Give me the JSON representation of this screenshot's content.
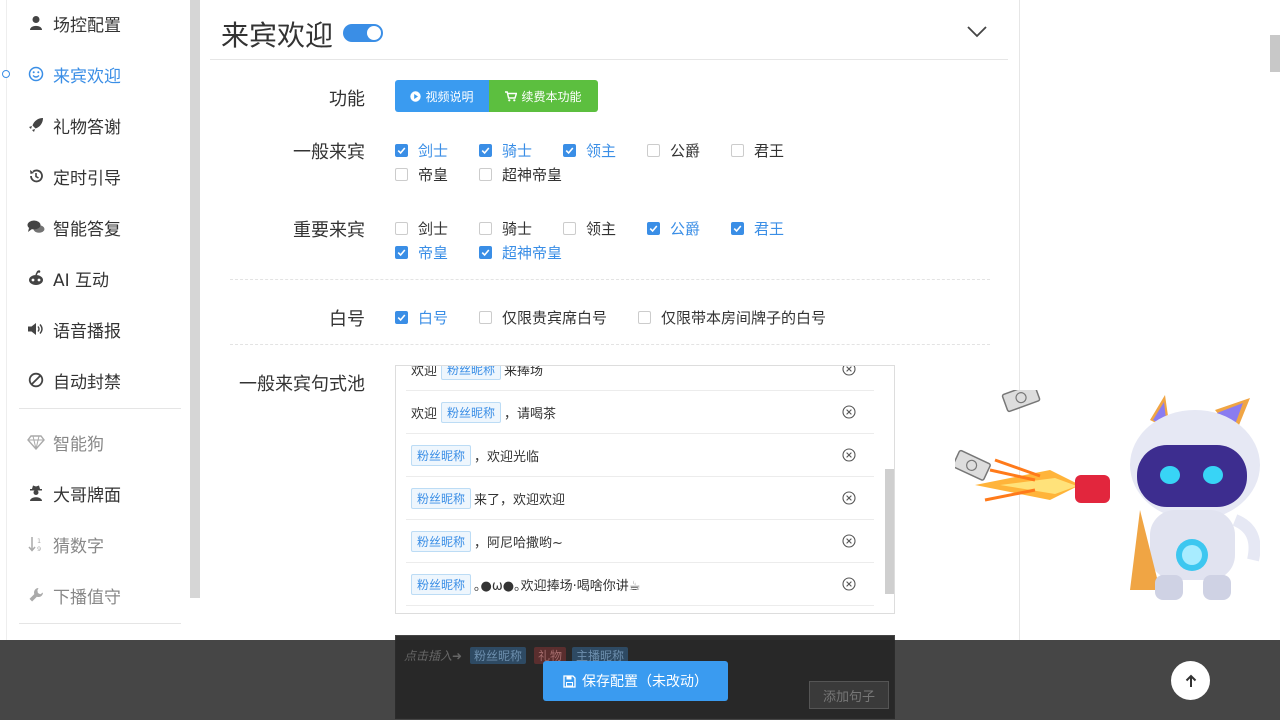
{
  "sidebar": {
    "items": [
      {
        "label": "场控配置",
        "icon": "user-icon",
        "state": "normal"
      },
      {
        "label": "来宾欢迎",
        "icon": "smile-icon",
        "state": "active"
      },
      {
        "label": "礼物答谢",
        "icon": "rocket-icon",
        "state": "normal"
      },
      {
        "label": "定时引导",
        "icon": "history-icon",
        "state": "normal"
      },
      {
        "label": "智能答复",
        "icon": "comments-icon",
        "state": "normal"
      },
      {
        "label": "AI 互动",
        "icon": "robot-icon",
        "state": "normal"
      },
      {
        "label": "语音播报",
        "icon": "volume-icon",
        "state": "normal"
      },
      {
        "label": "自动封禁",
        "icon": "ban-icon",
        "state": "normal"
      },
      {
        "label": "智能狗",
        "icon": "diamond-icon",
        "state": "muted"
      },
      {
        "label": "大哥牌面",
        "icon": "user-secret-icon",
        "state": "normal"
      },
      {
        "label": "猜数字",
        "icon": "sort-numeric-icon",
        "state": "muted"
      },
      {
        "label": "下播值守",
        "icon": "wrench-icon",
        "state": "muted"
      }
    ]
  },
  "panel": {
    "title": "来宾欢迎",
    "enabled": true
  },
  "function_row": {
    "label": "功能",
    "video_button": "视频说明",
    "renew_button": "续费本功能"
  },
  "normal_guests": {
    "label": "一般来宾",
    "options": [
      {
        "text": "剑士",
        "checked": true
      },
      {
        "text": "骑士",
        "checked": true
      },
      {
        "text": "领主",
        "checked": true
      },
      {
        "text": "公爵",
        "checked": false
      },
      {
        "text": "君王",
        "checked": false
      },
      {
        "text": "帝皇",
        "checked": false
      },
      {
        "text": "超神帝皇",
        "checked": false
      }
    ]
  },
  "vip_guests": {
    "label": "重要来宾",
    "options": [
      {
        "text": "剑士",
        "checked": false
      },
      {
        "text": "骑士",
        "checked": false
      },
      {
        "text": "领主",
        "checked": false
      },
      {
        "text": "公爵",
        "checked": true
      },
      {
        "text": "君王",
        "checked": true
      },
      {
        "text": "帝皇",
        "checked": true
      },
      {
        "text": "超神帝皇",
        "checked": true
      }
    ]
  },
  "white_name": {
    "label": "白号",
    "options": [
      {
        "text": "白号",
        "checked": true
      },
      {
        "text": "仅限贵宾席白号",
        "checked": false
      },
      {
        "text": "仅限带本房间牌子的白号",
        "checked": false
      }
    ]
  },
  "phrase_pool": {
    "label": "一般来宾句式池",
    "tag": "粉丝昵称",
    "rows": [
      {
        "before": "欢迎",
        "after": "来捧场"
      },
      {
        "before": "欢迎",
        "after": "，请喝茶"
      },
      {
        "before": "",
        "after": "，欢迎光临"
      },
      {
        "before": "",
        "after": "来了，欢迎欢迎"
      },
      {
        "before": "",
        "after": "，阿尼哈撒哟~"
      },
      {
        "before": "",
        "after": "｡●ω●｡欢迎捧场·喝啥你讲☕"
      }
    ]
  },
  "editor": {
    "hint": "点击插入➜",
    "tags": [
      "粉丝昵称",
      "礼物",
      "主播昵称"
    ],
    "add_button": "添加句子"
  },
  "save_button": "保存配置（未改动）",
  "colors": {
    "accent": "#3a8ee6",
    "button_blue": "#3a9bf0",
    "button_green": "#5cbf3f"
  }
}
